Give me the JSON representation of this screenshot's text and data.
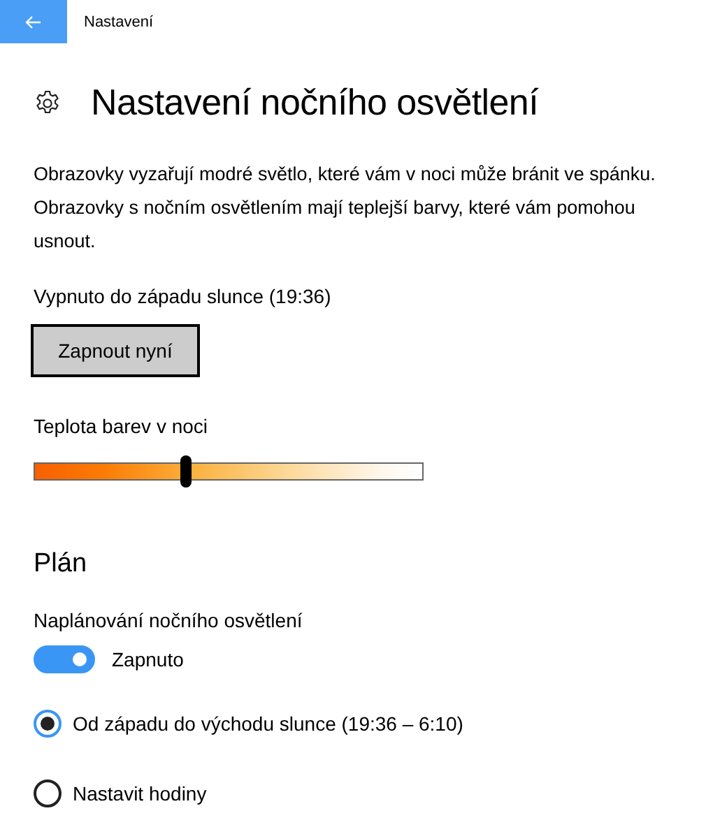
{
  "window": {
    "title": "Nastavení"
  },
  "page": {
    "title": "Nastavení nočního osvětlení",
    "description": "Obrazovky vyzařují modré světlo, které vám v noci může bránit ve spánku. Obrazovky s nočním osvětlením mají teplejší barvy, které vám pomohou usnout.",
    "status": "Vypnuto do západu slunce (19:36)",
    "button": "Zapnout nyní"
  },
  "temperature": {
    "label": "Teplota barev v noci",
    "level": 0.39
  },
  "schedule": {
    "heading": "Plán",
    "label": "Naplánování nočního osvětlení",
    "toggle": {
      "on": true,
      "label": "Zapnuto"
    },
    "options": [
      {
        "label": "Od západu do východu slunce (19:36 – 6:10)",
        "selected": true
      },
      {
        "label": "Nastavit hodiny",
        "selected": false
      }
    ]
  }
}
